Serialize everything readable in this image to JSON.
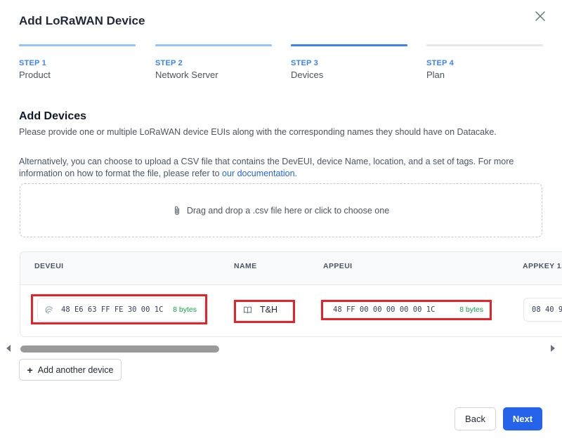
{
  "dialog": {
    "title": "Add LoRaWAN Device",
    "close_icon": "close-icon"
  },
  "steps": [
    {
      "number": "STEP 1",
      "label": "Product",
      "state": "complete",
      "color": "#93c5fd"
    },
    {
      "number": "STEP 2",
      "label": "Network Server",
      "state": "complete",
      "color": "#93c5fd"
    },
    {
      "number": "STEP 3",
      "label": "Devices",
      "state": "current",
      "color": "#3b82f6"
    },
    {
      "number": "STEP 4",
      "label": "Plan",
      "state": "upcoming",
      "color": "#e5e7eb"
    }
  ],
  "section": {
    "title": "Add Devices",
    "description": "Please provide one or multiple LoRaWAN device EUIs along with the corresponding names they should have on Datacake.",
    "csv_text": "Alternatively, you can choose to upload a CSV file that contains the DevEUI, device Name, location, and a set of tags. For more information on how to format the file, please refer to ",
    "csv_link": "our documentation",
    "csv_end": "."
  },
  "dropzone": {
    "text": "Drag and drop a .csv file here or click to choose one",
    "icon": "paperclip-icon"
  },
  "table": {
    "headers": {
      "deveui": "DEVEUI",
      "name": "NAME",
      "appeui": "APPEUI",
      "appkey": "APPKEY 1."
    },
    "rows": [
      {
        "deveui": "48 E6 63 FF FE 30 00 1C",
        "deveui_bytes": "8 bytes",
        "name": "T&H",
        "appeui": "48 FF 00 00 00 00 00 1C",
        "appeui_bytes": "8 bytes",
        "appkey": "08 40 9"
      }
    ]
  },
  "buttons": {
    "add_device": "Add another device",
    "back": "Back",
    "next": "Next"
  },
  "colors": {
    "accent": "#2563eb",
    "highlight": "#e52329",
    "bytes": "#16a34a"
  }
}
